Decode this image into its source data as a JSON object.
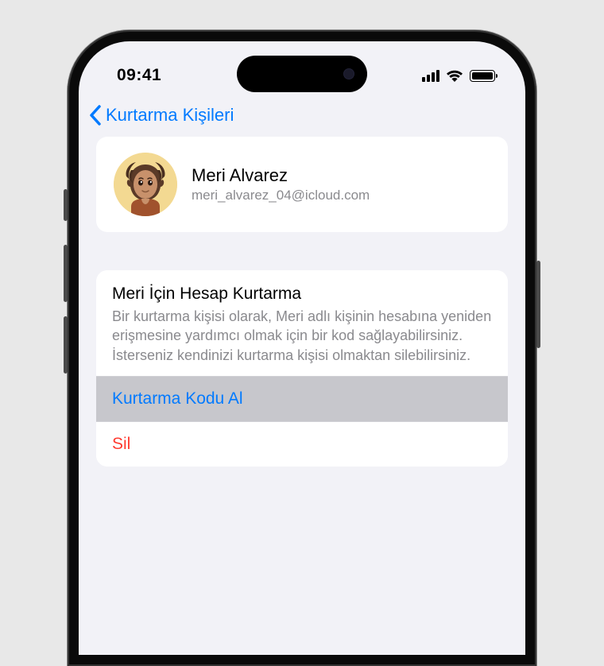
{
  "statusBar": {
    "time": "09:41"
  },
  "nav": {
    "backLabel": "Kurtarma Kişileri"
  },
  "contact": {
    "name": "Meri Alvarez",
    "email": "meri_alvarez_04@icloud.com"
  },
  "recovery": {
    "title": "Meri İçin Hesap Kurtarma",
    "description": "Bir kurtarma kişisi olarak, Meri adlı kişinin hesabına yeniden erişmesine yardımcı olmak için bir kod sağlayabilirsiniz. İsterseniz kendinizi kurtarma kişisi olmaktan silebilirsiniz.",
    "getCodeLabel": "Kurtarma Kodu Al",
    "deleteLabel": "Sil"
  }
}
